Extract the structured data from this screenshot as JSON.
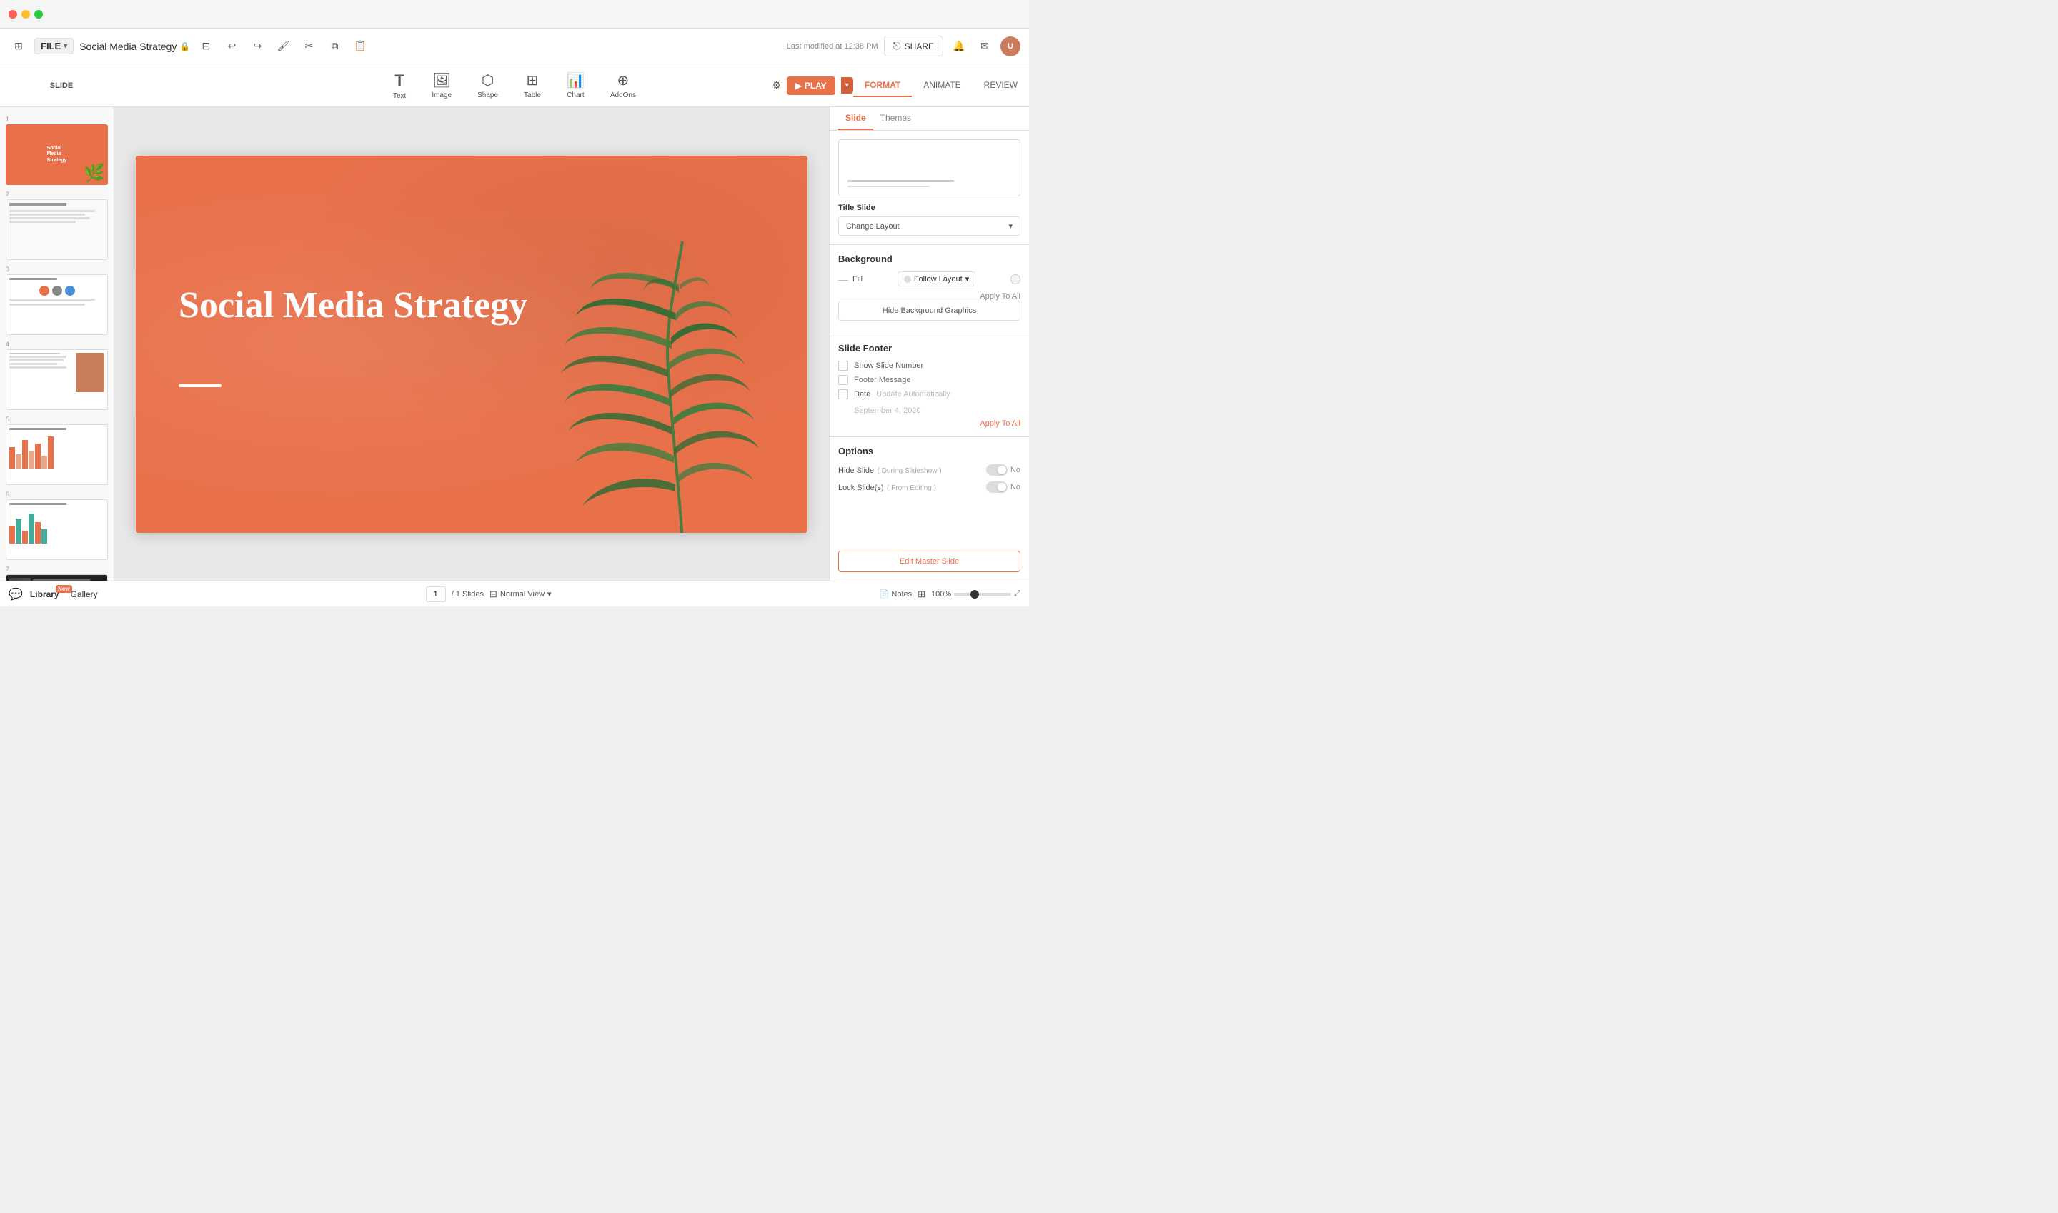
{
  "app": {
    "traffic_lights": [
      "red",
      "yellow",
      "green"
    ],
    "title": "Social Media Strategy",
    "modified_text": "Last modified at 12:38 PM",
    "file_label": "FILE",
    "share_label": "SHARE",
    "play_label": "PLAY"
  },
  "toolbar": {
    "undo_label": "↩",
    "redo_label": "↪",
    "insert_items": [
      {
        "label": "Text",
        "icon": "T"
      },
      {
        "label": "Image",
        "icon": "🖼"
      },
      {
        "label": "Shape",
        "icon": "⬡"
      },
      {
        "label": "Table",
        "icon": "⊞"
      },
      {
        "label": "Chart",
        "icon": "📊"
      },
      {
        "label": "AddOns",
        "icon": "⊕"
      }
    ],
    "tabs": [
      {
        "label": "FORMAT",
        "active": true
      },
      {
        "label": "ANIMATE",
        "active": false
      },
      {
        "label": "REVIEW",
        "active": false
      }
    ]
  },
  "slide_panel": {
    "slide_label": "SLIDE"
  },
  "slides": [
    {
      "num": 1,
      "type": "title",
      "active": true
    },
    {
      "num": 2,
      "type": "overview"
    },
    {
      "num": 3,
      "type": "team"
    },
    {
      "num": 4,
      "type": "content"
    },
    {
      "num": 5,
      "type": "chart"
    },
    {
      "num": 6,
      "type": "chart2"
    },
    {
      "num": 7,
      "type": "dark"
    }
  ],
  "main_slide": {
    "title": "Social Media Strategy",
    "bg_color": "#e8714a"
  },
  "right_panel": {
    "tabs": [
      {
        "label": "Slide",
        "active": true
      },
      {
        "label": "Themes",
        "active": false
      }
    ],
    "layout_title": "Title Slide",
    "change_layout_label": "Change Layout",
    "background_title": "Background",
    "fill_label": "Fill",
    "fill_value": "Follow Layout",
    "apply_to_all_label": "Apply To All",
    "hide_bg_label": "Hide Background Graphics",
    "footer_title": "Slide Footer",
    "show_slide_number_label": "Show Slide Number",
    "footer_message_label": "Footer Message",
    "footer_message_placeholder": "Footer Message",
    "date_label": "Date",
    "update_auto_label": "Update Automatically",
    "date_value": "September 4, 2020",
    "apply_to_all_footer": "Apply To All",
    "options_title": "Options",
    "hide_slide_label": "Hide Slide",
    "hide_slide_sub": "( During Slideshow )",
    "hide_slide_value": "No",
    "lock_slide_label": "Lock Slide(s)",
    "lock_slide_sub": "( From Editing )",
    "lock_slide_value": "No",
    "edit_master_label": "Edit Master Slide"
  },
  "bottom_bar": {
    "library_label": "Library",
    "gallery_label": "Gallery",
    "new_badge": "New",
    "page_current": "1",
    "page_total": "/ 1 Slides",
    "normal_view_label": "Normal View",
    "notes_label": "Notes",
    "zoom_pct": "100%"
  }
}
